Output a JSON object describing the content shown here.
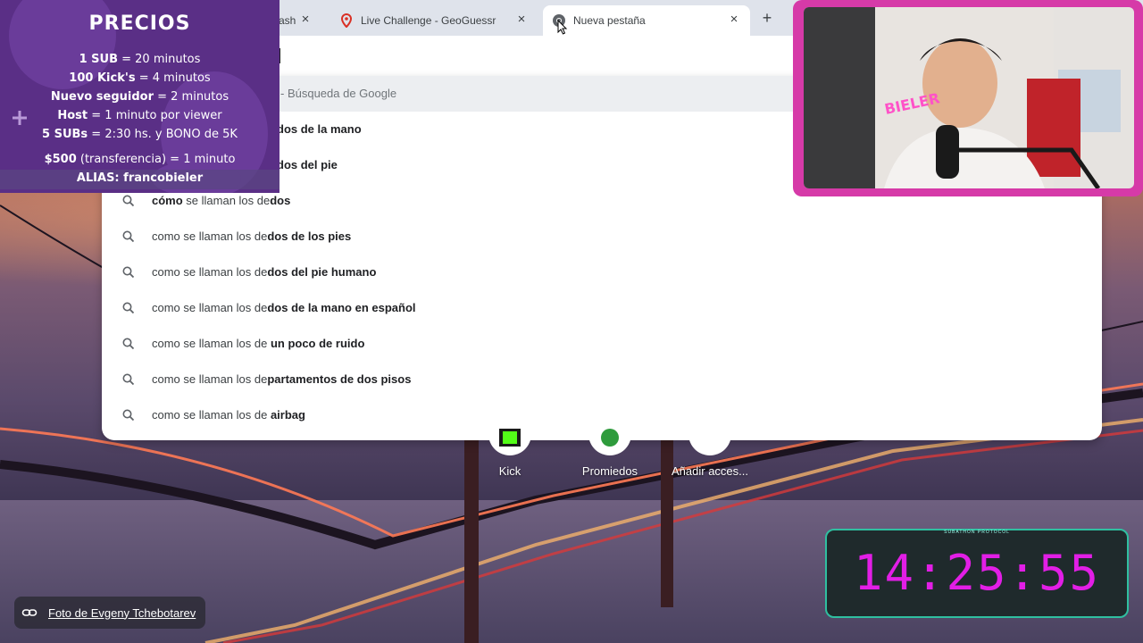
{
  "browser": {
    "tabs": [
      {
        "title": "ash",
        "favicon": "globe-icon"
      },
      {
        "title": "Live Challenge - GeoGuessr",
        "favicon": "location-pin-icon"
      },
      {
        "title": "Nueva pestaña",
        "favicon": "chrome-icon",
        "active": true
      }
    ],
    "new_tab_symbol": "+",
    "close_symbol": "×"
  },
  "omnibox": {
    "suggestions": [
      {
        "prefix": "",
        "bold": "",
        "suffix": "- Búsqueda de Google",
        "highlighted": true
      },
      {
        "prefix": "",
        "bold": "dos de la mano",
        "suffix": ""
      },
      {
        "prefix": "",
        "bold": "dos del pie",
        "suffix": ""
      },
      {
        "prefix": "cómo",
        "bold": "",
        "suffix": " se llaman los de",
        "tail_bold": "dos",
        "prefix_bold": true
      },
      {
        "prefix": "como se llaman los de",
        "bold": "dos de los pies",
        "suffix": ""
      },
      {
        "prefix": "como se llaman los de",
        "bold": "dos del pie humano",
        "suffix": ""
      },
      {
        "prefix": "como se llaman los de",
        "bold": "dos de la mano en español",
        "suffix": ""
      },
      {
        "prefix": "como se llaman los de ",
        "bold": "un poco de ruido",
        "suffix": ""
      },
      {
        "prefix": "como se llaman los de",
        "bold": "partamentos de dos pisos",
        "suffix": ""
      },
      {
        "prefix": "como se llaman los de ",
        "bold": "airbag",
        "suffix": ""
      }
    ]
  },
  "shortcuts": [
    {
      "label": "Kick",
      "icon": "kick-icon"
    },
    {
      "label": "Promiedos",
      "icon": "promiedos-icon"
    },
    {
      "label": "Añadir acces...",
      "icon": "plus-icon"
    }
  ],
  "photo_credit": "Foto de Evgeny Tchebotarev",
  "prices": {
    "title": "PRECIOS",
    "rows": [
      {
        "bold": "1 SUB",
        "rest": " = 20 minutos"
      },
      {
        "bold": "100 Kick's",
        "rest": " = 4 minutos"
      },
      {
        "bold": "Nuevo seguidor",
        "rest": " = 2 minutos"
      },
      {
        "bold": "Host",
        "rest": " = 1 minuto por viewer"
      },
      {
        "bold": "5 SUBs",
        "rest": " = 2:30 hs. y BONO de 5K"
      },
      {
        "bold": "$500",
        "rest": " (transferencia) = 1 minuto"
      },
      {
        "bold": "ALIAS: francobieler",
        "rest": ""
      }
    ]
  },
  "webcam": {
    "neon_sign": "BIELER"
  },
  "timer": {
    "label": "SUBATHON PROTOCOL",
    "value": "14:25:55"
  },
  "colors": {
    "prices_bg": "#5a2f86",
    "cam_frame": "#d63aa8",
    "timer_digits": "#e21ee6",
    "timer_border": "#2fbfa0"
  }
}
